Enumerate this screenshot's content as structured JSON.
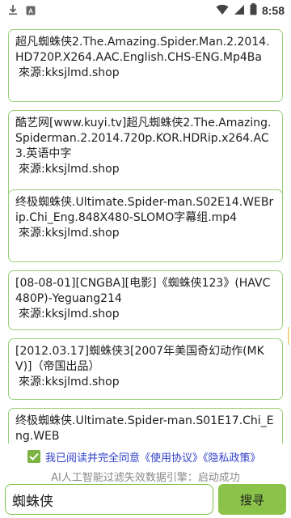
{
  "status_bar": {
    "time": "8:58",
    "icons": [
      "download-icon",
      "notification-a-icon",
      "wifi-icon",
      "signal-icon",
      "battery-icon"
    ]
  },
  "results": [
    {
      "title": "超凡蜘蛛侠2.The.Amazing.Spider.Man.2.2014.HD720P.X264.AAC.English.CHS-ENG.Mp4Ba",
      "source": "來源:kksjlmd.shop"
    },
    {
      "title": "酷艺网[www.kuyi.tv]超凡蜘蛛侠2.The.Amazing.Spiderman.2.2014.720p.KOR.HDRip.x264.AC3.英语中字",
      "source": "來源:kksjlmd.shop"
    },
    {
      "title": "终极蜘蛛侠.Ultimate.Spider-man.S02E14.WEBrip.Chi_Eng.848X480-SLOMO字幕组.mp4",
      "source": "來源:kksjlmd.shop"
    },
    {
      "title": "[08-08-01][CNGBA][电影]《蜘蛛侠123》(HAVC480P)-Yeguang214",
      "source": "來源:kksjlmd.shop"
    },
    {
      "title": "[2012.03.17]蜘蛛侠3[2007年美国奇幻动作(MKV)]（帝国出品）",
      "source": "來源:kksjlmd.shop"
    },
    {
      "title": "终极蜘蛛侠.Ultimate.Spider-man.S01E17.Chi_Eng.WEB",
      "source": ""
    }
  ],
  "agreement": {
    "checked": true,
    "text": "我已阅读并完全同意《使用协议》《隐私政策》"
  },
  "engine_status": "AI人工智能过滤失效数据引擎：启动成功",
  "search": {
    "value": "蜘蛛侠",
    "button_label": "搜寻"
  },
  "colors": {
    "accent_green": "#8bc34a",
    "card_border": "#9ad07a",
    "link_blue": "#2f3fc7"
  }
}
